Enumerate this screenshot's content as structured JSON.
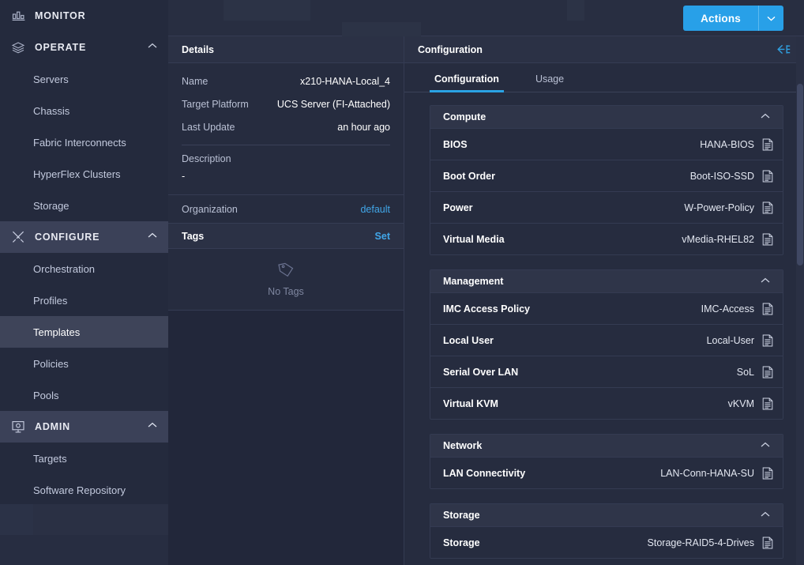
{
  "sidebar": {
    "groups": [
      {
        "label": "MONITOR",
        "icon": "monitor-chart-icon",
        "expandable": false,
        "highlight": false,
        "chevron": ""
      },
      {
        "label": "OPERATE",
        "icon": "layers-icon",
        "expandable": true,
        "highlight": false,
        "chevron": "chevron-up-icon"
      },
      {
        "label": "CONFIGURE",
        "icon": "tools-icon",
        "expandable": true,
        "highlight": true,
        "chevron": "chevron-up-icon"
      },
      {
        "label": "ADMIN",
        "icon": "admin-console-icon",
        "expandable": true,
        "highlight": true,
        "chevron": "chevron-up-icon"
      }
    ],
    "operate_items": [
      {
        "label": "Servers",
        "active": false
      },
      {
        "label": "Chassis",
        "active": false
      },
      {
        "label": "Fabric Interconnects",
        "active": false
      },
      {
        "label": "HyperFlex Clusters",
        "active": false
      },
      {
        "label": "Storage",
        "active": false
      }
    ],
    "configure_items": [
      {
        "label": "Orchestration",
        "active": false
      },
      {
        "label": "Profiles",
        "active": false
      },
      {
        "label": "Templates",
        "active": true
      },
      {
        "label": "Policies",
        "active": false
      },
      {
        "label": "Pools",
        "active": false
      }
    ],
    "admin_items": [
      {
        "label": "Targets",
        "active": false
      },
      {
        "label": "Software Repository",
        "active": false
      }
    ]
  },
  "topbar": {
    "actions_label": "Actions",
    "actions_caret_icon": "chevron-down-icon"
  },
  "details": {
    "title": "Details",
    "rows": [
      {
        "key": "Name",
        "value": "x210-HANA-Local_4"
      },
      {
        "key": "Target Platform",
        "value": "UCS Server (FI-Attached)"
      },
      {
        "key": "Last Update",
        "value": "an hour ago"
      }
    ],
    "description_label": "Description",
    "description_value": "-",
    "organization_label": "Organization",
    "organization_value": "default",
    "tags_label": "Tags",
    "tags_set_label": "Set",
    "tags_empty_text": "No Tags",
    "tags_empty_icon": "tag-icon"
  },
  "configuration": {
    "title": "Configuration",
    "collapse_icon": "collapse-panel-icon",
    "tabs": [
      {
        "label": "Configuration",
        "active": true
      },
      {
        "label": "Usage",
        "active": false
      }
    ],
    "sections": [
      {
        "title": "Compute",
        "chevron": "chevron-up-icon",
        "rows": [
          {
            "key": "BIOS",
            "value": "HANA-BIOS",
            "icon": "policy-document-icon"
          },
          {
            "key": "Boot Order",
            "value": "Boot-ISO-SSD",
            "icon": "policy-document-icon"
          },
          {
            "key": "Power",
            "value": "W-Power-Policy",
            "icon": "policy-document-icon"
          },
          {
            "key": "Virtual Media",
            "value": "vMedia-RHEL82",
            "icon": "policy-document-icon"
          }
        ]
      },
      {
        "title": "Management",
        "chevron": "chevron-up-icon",
        "rows": [
          {
            "key": "IMC Access Policy",
            "value": "IMC-Access",
            "icon": "policy-document-icon"
          },
          {
            "key": "Local User",
            "value": "Local-User",
            "icon": "policy-document-icon"
          },
          {
            "key": "Serial Over LAN",
            "value": "SoL",
            "icon": "policy-document-icon"
          },
          {
            "key": "Virtual KVM",
            "value": "vKVM",
            "icon": "policy-document-icon"
          }
        ]
      },
      {
        "title": "Network",
        "chevron": "chevron-up-icon",
        "rows": [
          {
            "key": "LAN Connectivity",
            "value": "LAN-Conn-HANA-SU",
            "icon": "policy-document-icon"
          }
        ]
      },
      {
        "title": "Storage",
        "chevron": "chevron-up-icon",
        "rows": [
          {
            "key": "Storage",
            "value": "Storage-RAID5-4-Drives",
            "icon": "policy-document-icon"
          }
        ]
      }
    ]
  },
  "colors": {
    "accent": "#28a0e8",
    "link": "#41a6e8",
    "sidebar_bg": "#242a3d",
    "panel_bg": "#262c3f",
    "section_header_bg": "#2f3549",
    "active_item_bg": "#3e4459"
  }
}
